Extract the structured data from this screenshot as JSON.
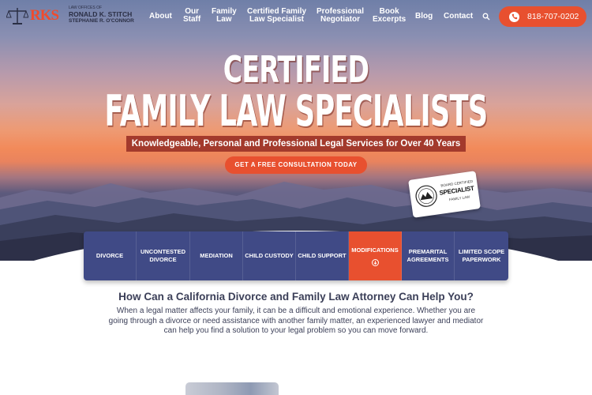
{
  "header": {
    "logo": {
      "monogram": "RKS",
      "small_text": "LAW OFFICES OF",
      "name_line1": "RONALD K. STITCH",
      "name_line2": "STEPHANIE R. O'CONNOR"
    },
    "nav": [
      {
        "lines": [
          "About"
        ]
      },
      {
        "lines": [
          "Our",
          "Staff"
        ]
      },
      {
        "lines": [
          "Family",
          "Law"
        ]
      },
      {
        "lines": [
          "Certified Family",
          "Law Specialist"
        ]
      },
      {
        "lines": [
          "Professional",
          "Negotiator"
        ]
      },
      {
        "lines": [
          "Book",
          "Excerpts"
        ]
      },
      {
        "lines": [
          "Blog"
        ]
      },
      {
        "lines": [
          "Contact"
        ]
      }
    ],
    "phone": "818-707-0202"
  },
  "hero": {
    "line1": "CERTIFIED",
    "line2": "FAMILY LAW SPECIALISTS",
    "tagline": "Knowledgeable, Personal and Professional Legal Services for Over 40 Years",
    "cta": "GET A FREE CONSULTATION TODAY",
    "badge": {
      "top": "BOARD CERTIFIED",
      "main": "SPECIALIST",
      "bottom": "FAMILY LAW"
    }
  },
  "practice_areas": [
    {
      "lines": [
        "DIVORCE"
      ],
      "active": false
    },
    {
      "lines": [
        "UNCONTESTED",
        "DIVORCE"
      ],
      "active": false
    },
    {
      "lines": [
        "MEDIATION"
      ],
      "active": false
    },
    {
      "lines": [
        "CHILD CUSTODY"
      ],
      "active": false
    },
    {
      "lines": [
        "CHILD SUPPORT"
      ],
      "active": false
    },
    {
      "lines": [
        "MODIFICATIONS"
      ],
      "active": true
    },
    {
      "lines": [
        "PREMARITAL",
        "AGREEMENTS"
      ],
      "active": false
    },
    {
      "lines": [
        "LIMITED SCOPE",
        "PAPERWORK"
      ],
      "active": false
    }
  ],
  "content": {
    "title": "How Can a California Divorce and Family Law Attorney Can Help You?",
    "body": "When a legal matter affects your family, it can be a difficult and emotional experience. Whether you are going through a divorce or need assistance with another family matter, an experienced lawyer and mediator can help you find a solution to your legal problem so you can move forward."
  },
  "colors": {
    "accent": "#e8502f",
    "navy": "#404a86",
    "tagline_bg": "#a33a2c",
    "text": "#3b3f58"
  },
  "icons": [
    "scales-icon",
    "search-icon",
    "phone-icon",
    "arrow-down-circle-icon",
    "seal-icon"
  ]
}
